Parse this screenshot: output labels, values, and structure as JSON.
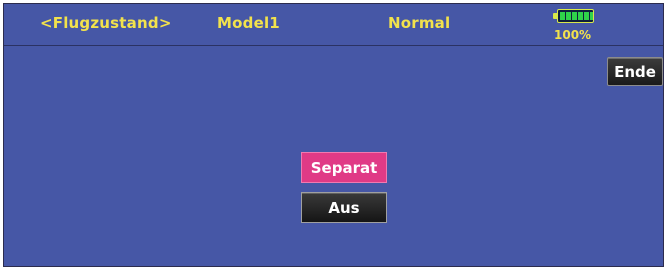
{
  "header": {
    "flight_condition": "<Flugzustand>",
    "model_name": "Model1",
    "condition_name": "Normal",
    "battery_percent": 100,
    "battery_label": "100%"
  },
  "buttons": {
    "end_label": "Ende",
    "mode_label": "Separat",
    "state_label": "Aus"
  },
  "colors": {
    "screen_background": "#4657a6",
    "header_text": "#f2e24c",
    "mode_button": "#e03a86",
    "dark_button": "#1a1a1a",
    "battery_fill": "#2fd24a"
  },
  "icons": {
    "battery": "battery-icon"
  }
}
